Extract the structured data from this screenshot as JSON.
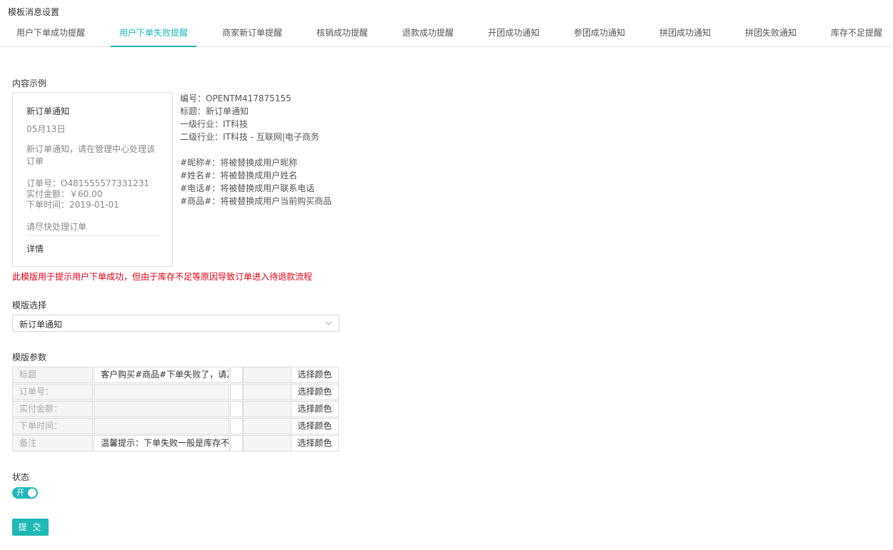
{
  "page_title": "模板消息设置",
  "tabs": [
    {
      "label": "用户下单成功提醒",
      "active": false
    },
    {
      "label": "用户下单失败提醒",
      "active": true
    },
    {
      "label": "商家新订单提醒",
      "active": false
    },
    {
      "label": "核销成功提醒",
      "active": false
    },
    {
      "label": "退款成功提醒",
      "active": false
    },
    {
      "label": "开团成功通知",
      "active": false
    },
    {
      "label": "参团成功通知",
      "active": false
    },
    {
      "label": "拼团成功通知",
      "active": false
    },
    {
      "label": "拼团失败通知",
      "active": false
    },
    {
      "label": "库存不足提醒",
      "active": false
    }
  ],
  "content_example": {
    "label": "内容示例",
    "preview": {
      "title": "新订单通知",
      "date": "05月13日",
      "intro": "新订单通知，请在管理中心处理该订单",
      "order_no": "订单号：O481555577331231",
      "paid": "实付金额：￥60.00",
      "order_time": "下单时间：2019-01-01",
      "remark": "请尽快处理订单",
      "detail": "详情"
    },
    "info": {
      "code": "编号：OPENTM417875155",
      "title": "标题：新订单通知",
      "industry1": "一级行业：IT科技",
      "industry2": "二级行业：IT科技 - 互联网|电子商务",
      "vars": [
        "#昵称#：将被替换成用户昵称",
        "#姓名#：将被替换成用户姓名",
        "#电话#：将被替换成用户联系电话",
        "#商品#：将被替换成用户当前购买商品"
      ]
    }
  },
  "warning_note": "此模版用于提示用户下单成功，但由于库存不足等原因导致订单进入待退款流程",
  "template_select": {
    "label": "模版选择",
    "value": "新订单通知"
  },
  "template_params": {
    "label": "模版参数",
    "color_button_label": "选择颜色",
    "rows": [
      {
        "label": "标题",
        "value": "客户购买#商品#下单失败了，请及",
        "filled": true
      },
      {
        "label": "订单号：",
        "value": "",
        "filled": false
      },
      {
        "label": "实付金额：",
        "value": "",
        "filled": false
      },
      {
        "label": "下单时间：",
        "value": "",
        "filled": false
      },
      {
        "label": "备注",
        "value": "温馨提示：下单失败一般是库存不足",
        "filled": true
      }
    ]
  },
  "status": {
    "label": "状态",
    "toggle_label": "开",
    "enabled": true
  },
  "submit_label": "提 交",
  "colors": {
    "accent": "#1fb8b5",
    "warning": "#e60012"
  }
}
